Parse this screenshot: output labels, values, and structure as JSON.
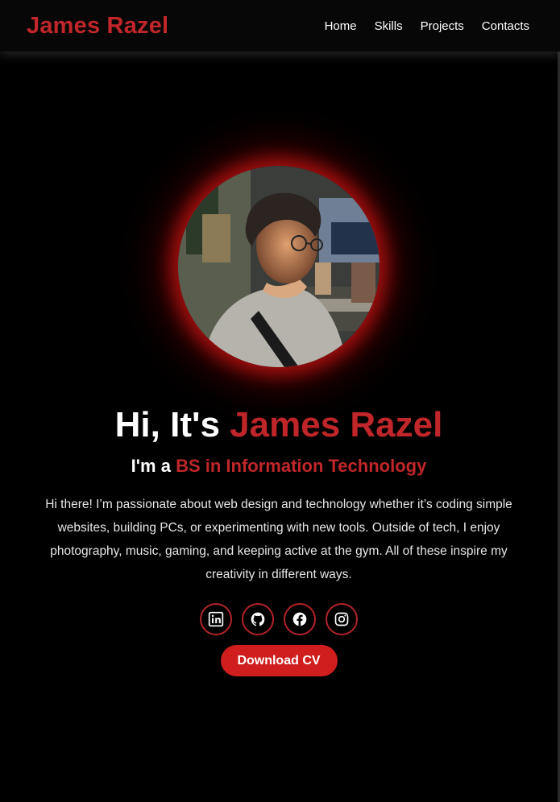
{
  "header": {
    "brand": "James Razel",
    "nav": [
      {
        "label": "Home"
      },
      {
        "label": "Skills"
      },
      {
        "label": "Projects"
      },
      {
        "label": "Contacts"
      }
    ]
  },
  "hero": {
    "greeting_prefix": "Hi, It's",
    "name": "James Razel",
    "role_prefix": "I'm a",
    "role": "BS in Information Technology",
    "about": "Hi there! I’m passionate about web design and technology whether it’s coding simple websites, building PCs, or experimenting with new tools. Outside of tech, I enjoy photography, music, gaming, and keeping active at the gym. All of these inspire my creativity in different ways.",
    "socials": [
      {
        "icon": "linkedin-icon"
      },
      {
        "icon": "github-icon"
      },
      {
        "icon": "facebook-icon"
      },
      {
        "icon": "instagram-icon"
      }
    ],
    "cta_label": "Download CV"
  },
  "colors": {
    "accent": "#c0262a",
    "button": "#d01e1e",
    "background": "#000000",
    "navbar": "#070707"
  }
}
